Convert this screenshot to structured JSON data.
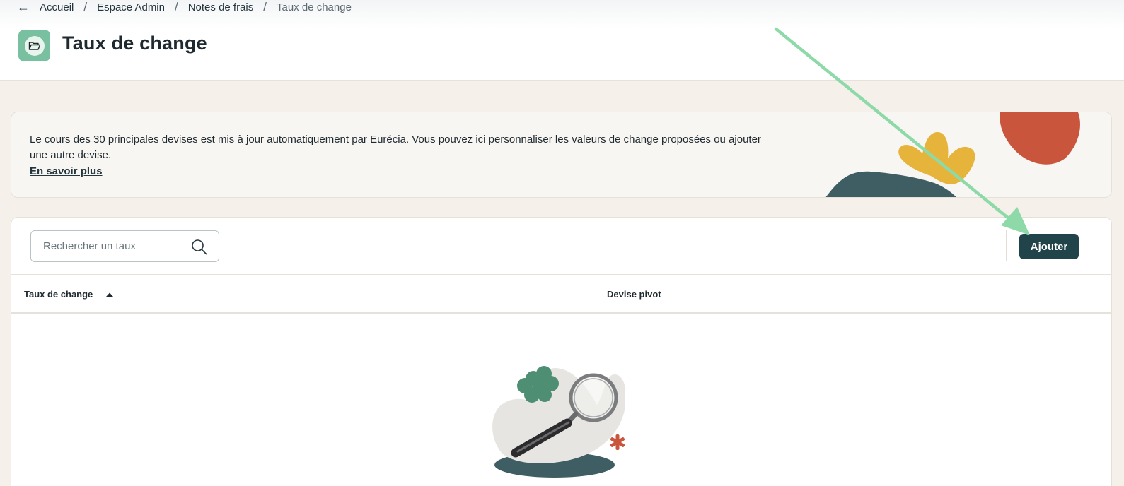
{
  "breadcrumb": {
    "back_icon": "arrow-left-icon",
    "items": [
      "Accueil",
      "Espace Admin",
      "Notes de frais"
    ],
    "separator": "/",
    "current": "Taux de change"
  },
  "header": {
    "title": "Taux de change",
    "icon": "open-folder-icon",
    "icon_color": "#78c0a0"
  },
  "info_card": {
    "text": "Le cours des 30 principales devises est mis à jour automatiquement par Eurécia. Vous pouvez ici personnaliser les valeurs de change proposées ou ajouter une autre devise.",
    "link": "En savoir plus"
  },
  "toolbar": {
    "search_placeholder": "Rechercher un taux",
    "search_value": "",
    "add_label": "Ajouter",
    "add_color": "#21434a"
  },
  "table": {
    "columns": [
      "Taux de change",
      "Devise pivot"
    ],
    "sort": "ascending",
    "rows": []
  },
  "annotation": {
    "arrow_color": "#8ed9a8"
  }
}
